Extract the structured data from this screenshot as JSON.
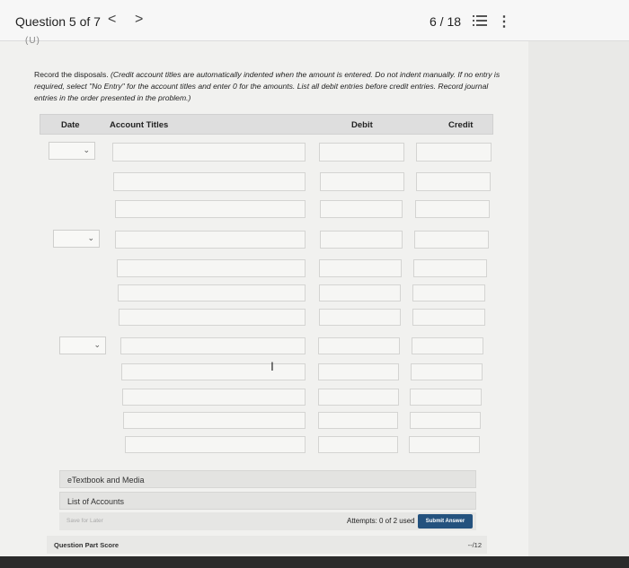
{
  "header": {
    "question_label": "Question 5 of 7",
    "prev_symbol": "<",
    "next_symbol": ">",
    "page_count": "6 / 18",
    "more_symbol": "⋮"
  },
  "cut_text": "(U)",
  "instructions": {
    "lead": "Record the disposals. ",
    "note": "(Credit account titles are automatically indented when the amount is entered. Do not indent manually. If no entry is required, select \"No Entry\" for the account titles and enter 0 for the amounts. List all debit entries before credit entries. Record journal entries in the order presented in the problem.)"
  },
  "table": {
    "columns": {
      "date": "Date",
      "account": "Account Titles",
      "debit": "Debit",
      "credit": "Credit"
    },
    "date_chevron": "⌄"
  },
  "cursor_glyph": "I",
  "links": {
    "etextbook": "eTextbook and Media",
    "accounts": "List of Accounts"
  },
  "footer": {
    "save_later": "Save for Later",
    "attempts": "Attempts: 0 of 2 used",
    "submit": "Submit Answer"
  },
  "score": {
    "label": "Question Part Score",
    "value": "--/12"
  },
  "colors": {
    "submit_bg": "#24527e",
    "header_bg": "#dedede"
  }
}
